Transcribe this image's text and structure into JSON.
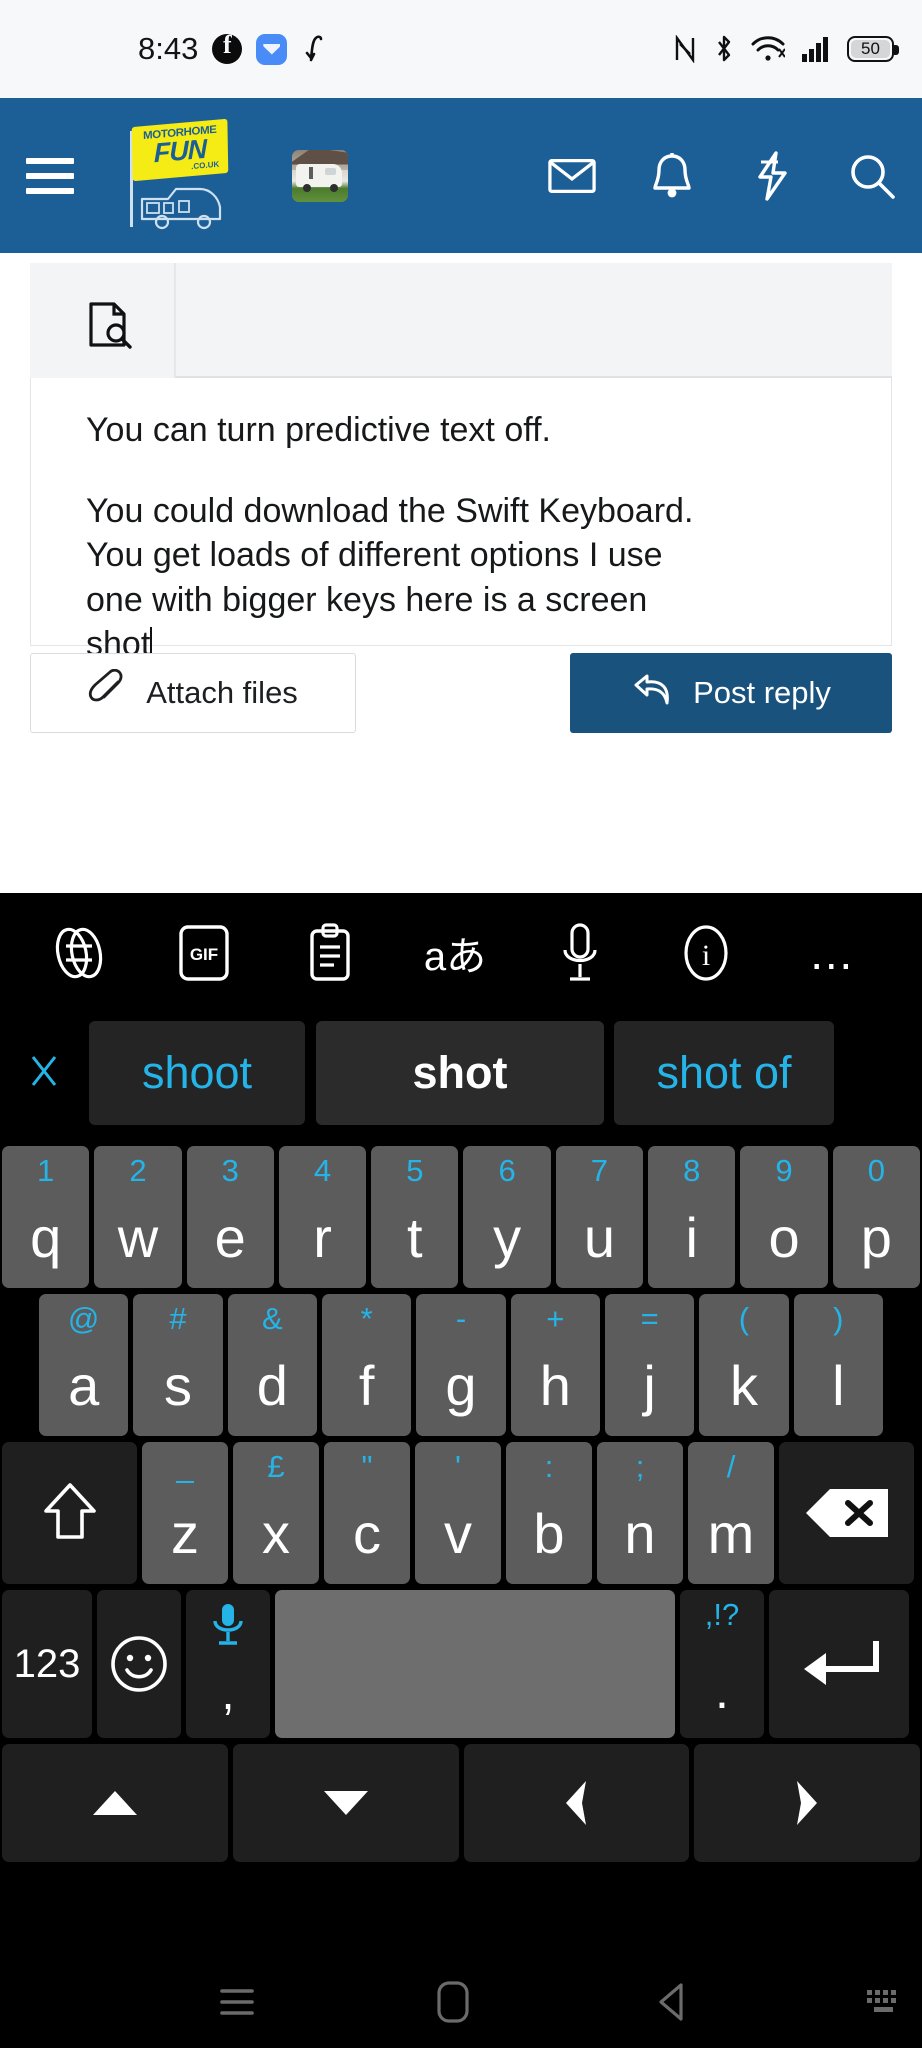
{
  "status_bar": {
    "clock": "8:43",
    "left_icons": [
      "facebook-icon",
      "messenger-icon",
      "call-divert-icon"
    ],
    "right_icons": [
      "nfc-icon",
      "bluetooth-icon",
      "wifi-icon",
      "cellular-signal-icon"
    ],
    "battery_level": "50",
    "background": "#f7f8fa"
  },
  "app_header": {
    "background": "#1c5f97",
    "menu_icon": "hamburger-menu-icon",
    "logo": {
      "name": "motorhome-fun-logo",
      "line1": "MOTORHOME",
      "line2": "FUN",
      "line3": ".CO.UK"
    },
    "avatar": "user-avatar-motorhome-photo",
    "icons": [
      "mail-icon",
      "bell-icon",
      "lightning-bolt-icon",
      "search-icon"
    ]
  },
  "editor": {
    "toolbar_icon": "document-preview-icon",
    "paragraph1": "You can turn predictive text off.",
    "paragraph2_line1": "You could download the Swift Keyboard.",
    "paragraph2_line2": "You get loads of different options I use",
    "paragraph2_line3": "one with bigger keys here is a screen",
    "paragraph2_line4": "shot",
    "attach_label": "Attach files",
    "attach_icon": "paperclip-icon",
    "post_label": "Post reply",
    "post_icon": "reply-arrow-icon",
    "post_button_color": "#19527d"
  },
  "keyboard": {
    "theme_background": "#000000",
    "key_color": "#5c5c5c",
    "dark_key_color": "#1f1f1f",
    "space_key_color": "#6e6e6e",
    "accent_color": "#25b4e8",
    "toolbar_icons": [
      "swiftkey-logo-icon",
      "gif-icon",
      "clipboard-icon",
      "translate-icon",
      "microphone-icon",
      "info-icon",
      "more-options-icon"
    ],
    "toolbar_labels": {
      "gif": "GIF",
      "translate": "aあ",
      "info": "i",
      "more": "…"
    },
    "predictions": {
      "close_icon": "close-predictions-icon",
      "items": [
        {
          "text": "shoot",
          "active": false
        },
        {
          "text": "shot",
          "active": true
        },
        {
          "text": "shot of",
          "active": false
        }
      ]
    },
    "row1": [
      {
        "letter": "q",
        "alt": "1"
      },
      {
        "letter": "w",
        "alt": "2"
      },
      {
        "letter": "e",
        "alt": "3"
      },
      {
        "letter": "r",
        "alt": "4"
      },
      {
        "letter": "t",
        "alt": "5"
      },
      {
        "letter": "y",
        "alt": "6"
      },
      {
        "letter": "u",
        "alt": "7"
      },
      {
        "letter": "i",
        "alt": "8"
      },
      {
        "letter": "o",
        "alt": "9"
      },
      {
        "letter": "p",
        "alt": "0"
      }
    ],
    "row2": [
      {
        "letter": "a",
        "alt": "@"
      },
      {
        "letter": "s",
        "alt": "#"
      },
      {
        "letter": "d",
        "alt": "&"
      },
      {
        "letter": "f",
        "alt": "*"
      },
      {
        "letter": "g",
        "alt": "-"
      },
      {
        "letter": "h",
        "alt": "+"
      },
      {
        "letter": "j",
        "alt": "="
      },
      {
        "letter": "k",
        "alt": "("
      },
      {
        "letter": "l",
        "alt": ")"
      }
    ],
    "row3": [
      {
        "letter": "z",
        "alt": "_"
      },
      {
        "letter": "x",
        "alt": "£"
      },
      {
        "letter": "c",
        "alt": "\""
      },
      {
        "letter": "v",
        "alt": "'"
      },
      {
        "letter": "b",
        "alt": ":"
      },
      {
        "letter": "n",
        "alt": ";"
      },
      {
        "letter": "m",
        "alt": "/"
      }
    ],
    "shift_icon": "shift-key-icon",
    "backspace_icon": "backspace-key-icon",
    "row4": {
      "numeric_label": "123",
      "emoji_icon": "emoji-smiley-icon",
      "mic_icon": "microphone-key-icon",
      "comma_label": ",",
      "space_label": "",
      "period_alt": ",!?",
      "period_label": ".",
      "enter_icon": "enter-key-icon"
    },
    "row5": [
      "arrow-up-key-icon",
      "arrow-down-key-icon",
      "arrow-left-key-icon",
      "arrow-right-key-icon"
    ]
  },
  "nav_bar": {
    "items": [
      "recents-nav-icon",
      "home-nav-icon",
      "back-nav-icon",
      "hide-keyboard-nav-icon"
    ]
  }
}
